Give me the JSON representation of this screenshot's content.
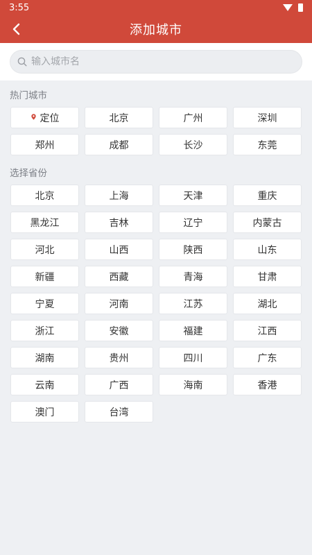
{
  "status_bar": {
    "time": "3:55"
  },
  "header": {
    "title": "添加城市"
  },
  "search": {
    "placeholder": "输入城市名"
  },
  "hot": {
    "title": "热门城市",
    "locate_label": "定位",
    "cities": [
      "北京",
      "广州",
      "深圳",
      "郑州",
      "成都",
      "长沙",
      "东莞"
    ]
  },
  "provinces": {
    "title": "选择省份",
    "items": [
      "北京",
      "上海",
      "天津",
      "重庆",
      "黑龙江",
      "吉林",
      "辽宁",
      "内蒙古",
      "河北",
      "山西",
      "陕西",
      "山东",
      "新疆",
      "西藏",
      "青海",
      "甘肃",
      "宁夏",
      "河南",
      "江苏",
      "湖北",
      "浙江",
      "安徽",
      "福建",
      "江西",
      "湖南",
      "贵州",
      "四川",
      "广东",
      "云南",
      "广西",
      "海南",
      "香港",
      "澳门",
      "台湾"
    ]
  },
  "colors": {
    "accent": "#d0493a",
    "background": "#eef0f3"
  }
}
